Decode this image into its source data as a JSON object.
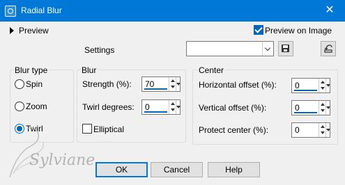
{
  "window": {
    "title": "Radial Blur",
    "close_glyph": "✕"
  },
  "preview": {
    "toggle_label": "Preview",
    "on_image_label": "Preview on Image",
    "on_image_checked": true
  },
  "settings": {
    "label": "Settings",
    "value": "",
    "save_icon": "floppy-disk-icon",
    "reset_icon": "reset-defaults-icon"
  },
  "blur_type": {
    "legend": "Blur type",
    "options": [
      {
        "label": "Spin",
        "selected": false
      },
      {
        "label": "Zoom",
        "selected": false
      },
      {
        "label": "Twirl",
        "selected": true
      }
    ]
  },
  "blur": {
    "legend": "Blur",
    "strength_label": "Strength (%):",
    "strength_value": "70",
    "twirl_label": "Twirl degrees:",
    "twirl_value": "0",
    "elliptical_label": "Elliptical",
    "elliptical_checked": false
  },
  "center": {
    "legend": "Center",
    "horizontal_label": "Horizontal offset (%):",
    "horizontal_value": "0",
    "vertical_label": "Vertical offset (%):",
    "vertical_value": "0",
    "protect_label": "Protect center (%):",
    "protect_value": "0"
  },
  "buttons": {
    "ok": "OK",
    "cancel": "Cancel",
    "help": "Help"
  },
  "watermark": "Sylviane",
  "colors": {
    "titlebar": "#0078d7",
    "accent": "#0067c0"
  }
}
